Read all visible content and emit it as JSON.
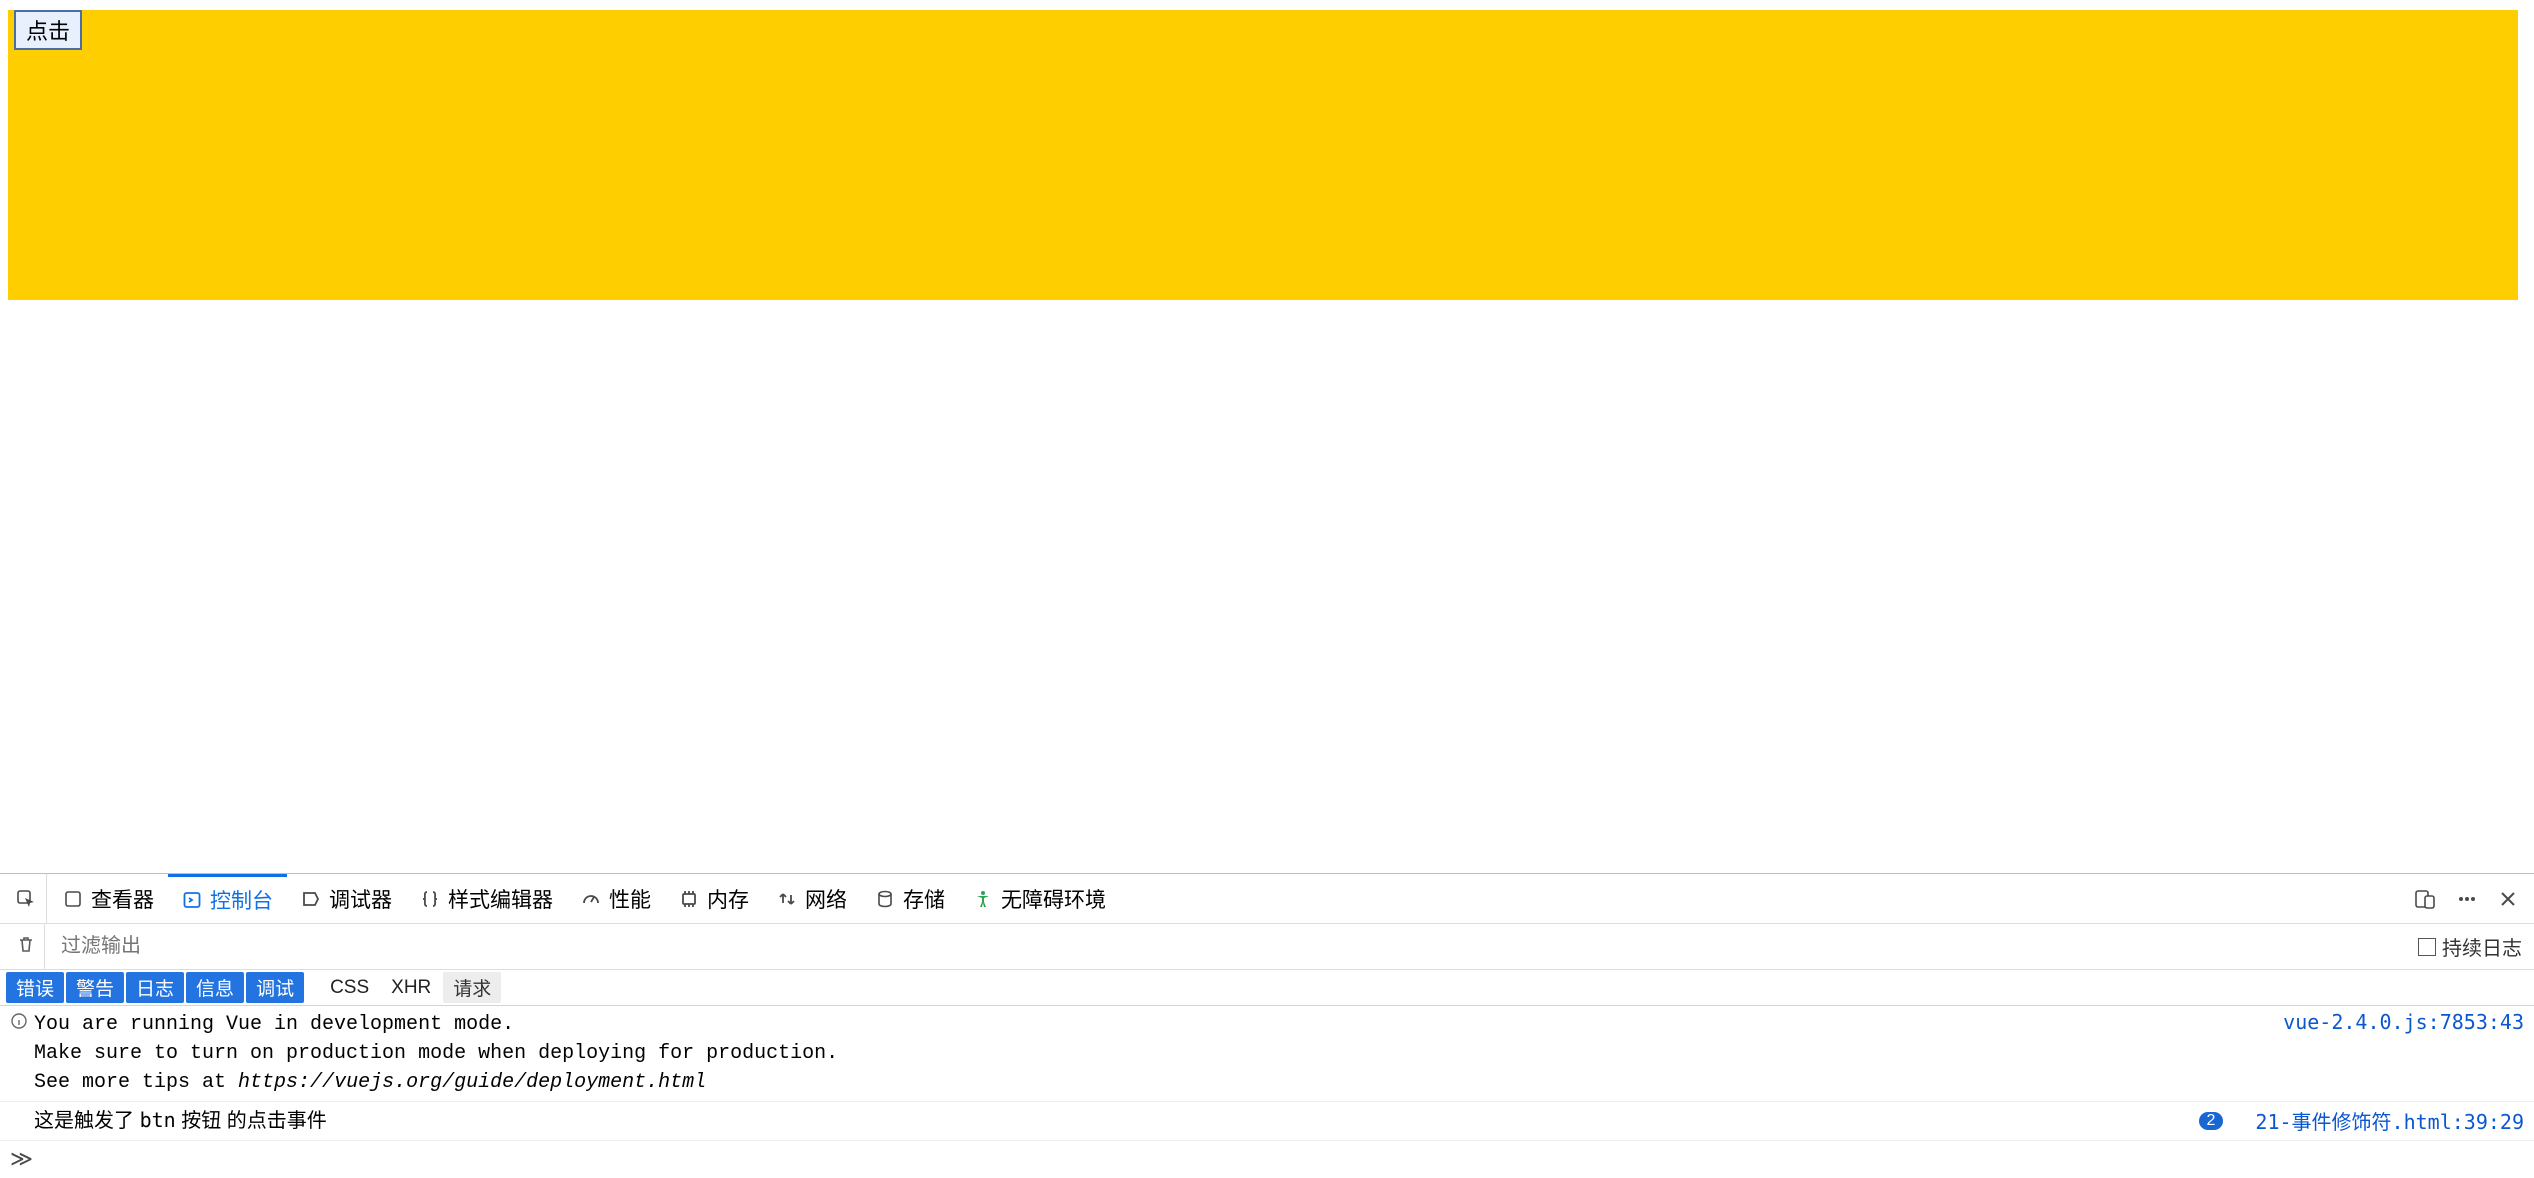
{
  "page": {
    "button_label": "点击"
  },
  "tabs": {
    "inspector": "查看器",
    "console": "控制台",
    "debugger": "调试器",
    "style": "样式编辑器",
    "performance": "性能",
    "memory": "内存",
    "network": "网络",
    "storage": "存储",
    "accessibility": "无障碍环境"
  },
  "filter": {
    "placeholder": "过滤输出",
    "persist_label": "持续日志"
  },
  "pills": {
    "error": "错误",
    "warn": "警告",
    "log": "日志",
    "info": "信息",
    "debug": "调试",
    "css": "CSS",
    "xhr": "XHR",
    "request": "请求"
  },
  "logs": {
    "vue": {
      "line1": "You are running Vue in development mode.",
      "line2": "Make sure to turn on production mode when deploying for production.",
      "line3a": "See more tips at ",
      "line3b": "https://vuejs.org/guide/deployment.html",
      "src": "vue-2.4.0.js:7853:43"
    },
    "custom": {
      "badge": "2",
      "text_a": "这是触发了 ",
      "text_b": "btn",
      "text_c": " 按钮 的点击事件",
      "src": "21-事件修饰符.html:39:29"
    }
  },
  "prompt": "≫"
}
